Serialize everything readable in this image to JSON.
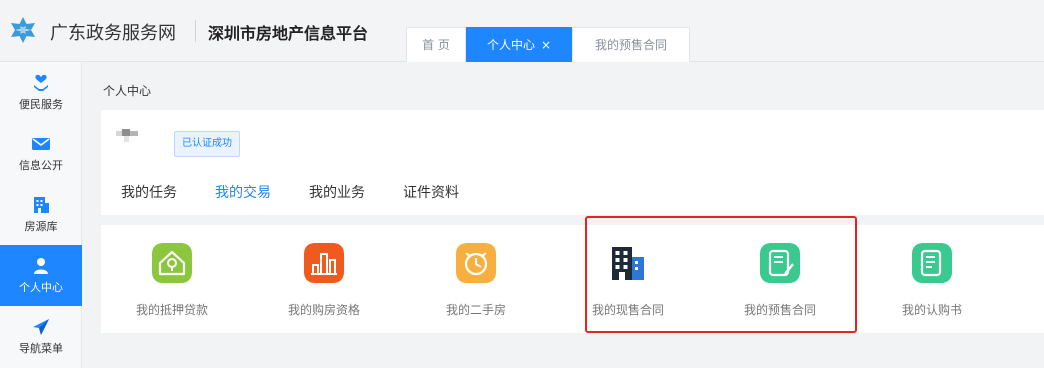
{
  "header": {
    "site_name": "广东政务服务网",
    "platform_name": "深圳市房地产信息平台",
    "brand_color": "#1e86ff",
    "logo_icon": "snowflake-logo-icon"
  },
  "tabs": [
    {
      "label": "首 页",
      "active": false
    },
    {
      "label": "个人中心",
      "active": true,
      "close": "×"
    },
    {
      "label": "我的预售合同",
      "active": false
    }
  ],
  "sidebar": {
    "items": [
      {
        "label": "便民服务",
        "icon": "heart-hand-icon",
        "active": false
      },
      {
        "label": "信息公开",
        "icon": "mail-icon",
        "active": false
      },
      {
        "label": "房源库",
        "icon": "building-icon",
        "active": false
      },
      {
        "label": "个人中心",
        "icon": "person-icon",
        "active": true
      },
      {
        "label": "导航菜单",
        "icon": "send-icon",
        "active": false
      }
    ]
  },
  "main": {
    "breadcrumb": "个人中心",
    "auth_badge": "已认证成功",
    "content_tabs": [
      {
        "label": "我的任务",
        "active": false
      },
      {
        "label": "我的交易",
        "active": true
      },
      {
        "label": "我的业务",
        "active": false
      },
      {
        "label": "证件资料",
        "active": false
      }
    ],
    "services": [
      {
        "label": "我的抵押贷款",
        "icon": "house-location-icon",
        "color": "#8cc63f"
      },
      {
        "label": "我的购房资格",
        "icon": "building-chart-icon",
        "color": "#f15a1f"
      },
      {
        "label": "我的二手房",
        "icon": "house-clock-icon",
        "color": "#f7b03f"
      },
      {
        "label": "我的现售合同",
        "icon": "office-building-icon",
        "color": "#1e2a3a"
      },
      {
        "label": "我的预售合同",
        "icon": "contract-edit-icon",
        "color": "#3ac98e"
      },
      {
        "label": "我的认购书",
        "icon": "document-edit-icon",
        "color": "#3ac98e"
      }
    ]
  }
}
